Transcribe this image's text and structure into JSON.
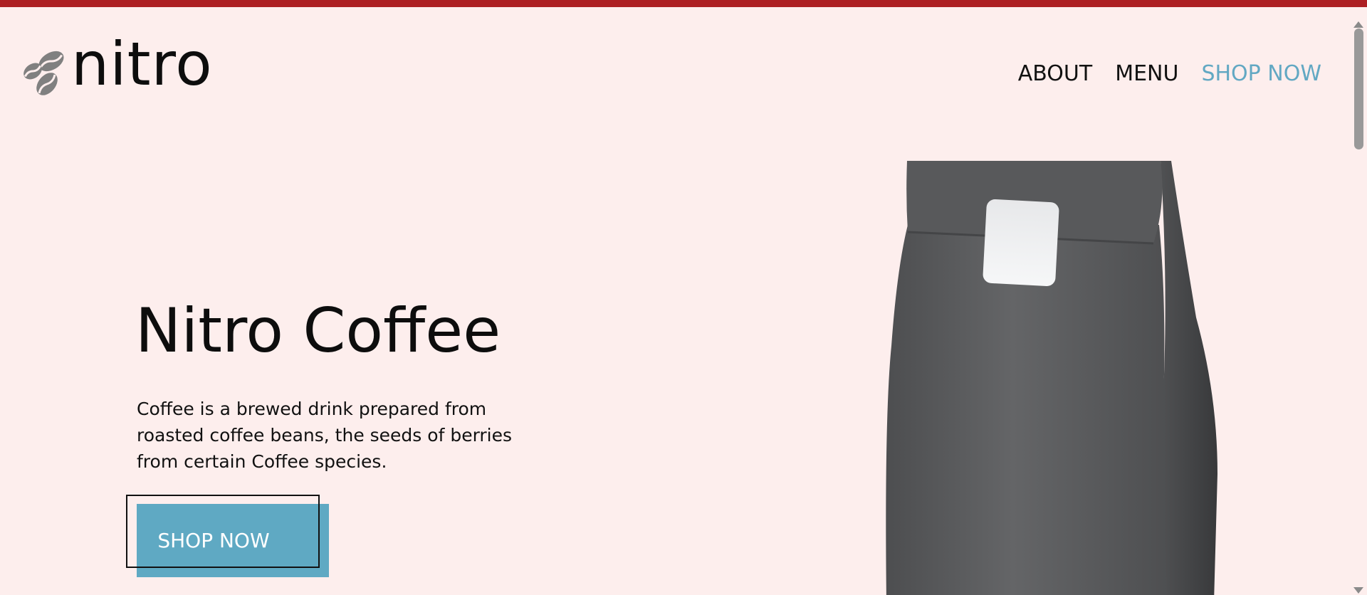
{
  "brand": {
    "logo_icon": "coffee-beans-icon",
    "name": "nitro"
  },
  "nav": {
    "items": [
      {
        "label": "ABOUT",
        "active": false
      },
      {
        "label": "MENU",
        "active": false
      },
      {
        "label": "SHOP NOW",
        "active": true
      }
    ],
    "active_color": "#62a8c3"
  },
  "hero": {
    "title": "Nitro Coffee",
    "description": "Coffee is a brewed drink prepared from roasted coffee beans, the seeds of berries from certain Coffee species.",
    "cta_label": "SHOP NOW",
    "image": "coffee-bag-image"
  },
  "colors": {
    "background": "#fdeeed",
    "topbar": "#ad1f23",
    "accent": "#5fa9c3",
    "text": "#0d0d0d"
  }
}
